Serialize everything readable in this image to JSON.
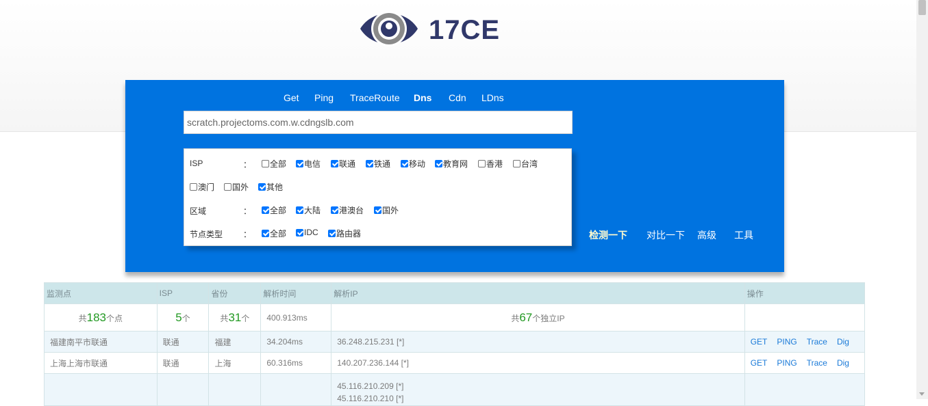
{
  "brand": {
    "name": "17CE"
  },
  "nav": [
    "Get",
    "Ping",
    "TraceRoute",
    "Dns",
    "Cdn",
    "LDns"
  ],
  "nav_active": "Dns",
  "url_input": {
    "value": "scratch.projectoms.com.w.cdngslb.com"
  },
  "options": {
    "isp_label": "ISP",
    "colon": "：",
    "isp": [
      {
        "label": "全部",
        "checked": false
      },
      {
        "label": "电信",
        "checked": true
      },
      {
        "label": "联通",
        "checked": true
      },
      {
        "label": "铁通",
        "checked": true
      },
      {
        "label": "移动",
        "checked": true
      },
      {
        "label": "教育网",
        "checked": true
      },
      {
        "label": "香港",
        "checked": false
      },
      {
        "label": "台湾",
        "checked": false
      },
      {
        "label": "澳门",
        "checked": false
      },
      {
        "label": "国外",
        "checked": false
      },
      {
        "label": "其他",
        "checked": true
      }
    ],
    "region_label": "区域",
    "region": [
      {
        "label": "全部",
        "checked": true
      },
      {
        "label": "大陆",
        "checked": true
      },
      {
        "label": "港澳台",
        "checked": true
      },
      {
        "label": "国外",
        "checked": true
      }
    ],
    "node_label": "节点类型",
    "node": [
      {
        "label": "全部",
        "checked": true
      },
      {
        "label": "IDC",
        "checked": true
      },
      {
        "label": "路由器",
        "checked": true
      }
    ]
  },
  "actions": {
    "detect": "检测一下",
    "compare": "对比一下",
    "advanced": "高级",
    "tools": "工具"
  },
  "table": {
    "headers": [
      "监测点",
      "ISP",
      "省份",
      "解析时间",
      "解析IP",
      "操作"
    ],
    "summary": {
      "points_prefix": "共",
      "points": "183",
      "points_suffix": "个点",
      "isp_count": "5",
      "isp_suffix": "个",
      "prov_prefix": "共",
      "prov_count": "31",
      "prov_suffix": "个",
      "time": "400.913ms",
      "ip_prefix": "共",
      "ip_count": "67",
      "ip_suffix": "个独立IP"
    },
    "rows": [
      {
        "point": "福建南平市联通",
        "isp": "联通",
        "province": "福建",
        "time": "34.204ms",
        "ips": [
          "36.248.215.231 [*]"
        ]
      },
      {
        "point": "上海上海市联通",
        "isp": "联通",
        "province": "上海",
        "time": "60.316ms",
        "ips": [
          "140.207.236.144 [*]"
        ]
      },
      {
        "point": "",
        "isp": "",
        "province": "",
        "time": "",
        "ips": [
          "45.116.210.209 [*]",
          "45.116.210.210 [*]"
        ]
      }
    ],
    "ops": [
      "GET",
      "PING",
      "Trace",
      "Dig"
    ]
  }
}
